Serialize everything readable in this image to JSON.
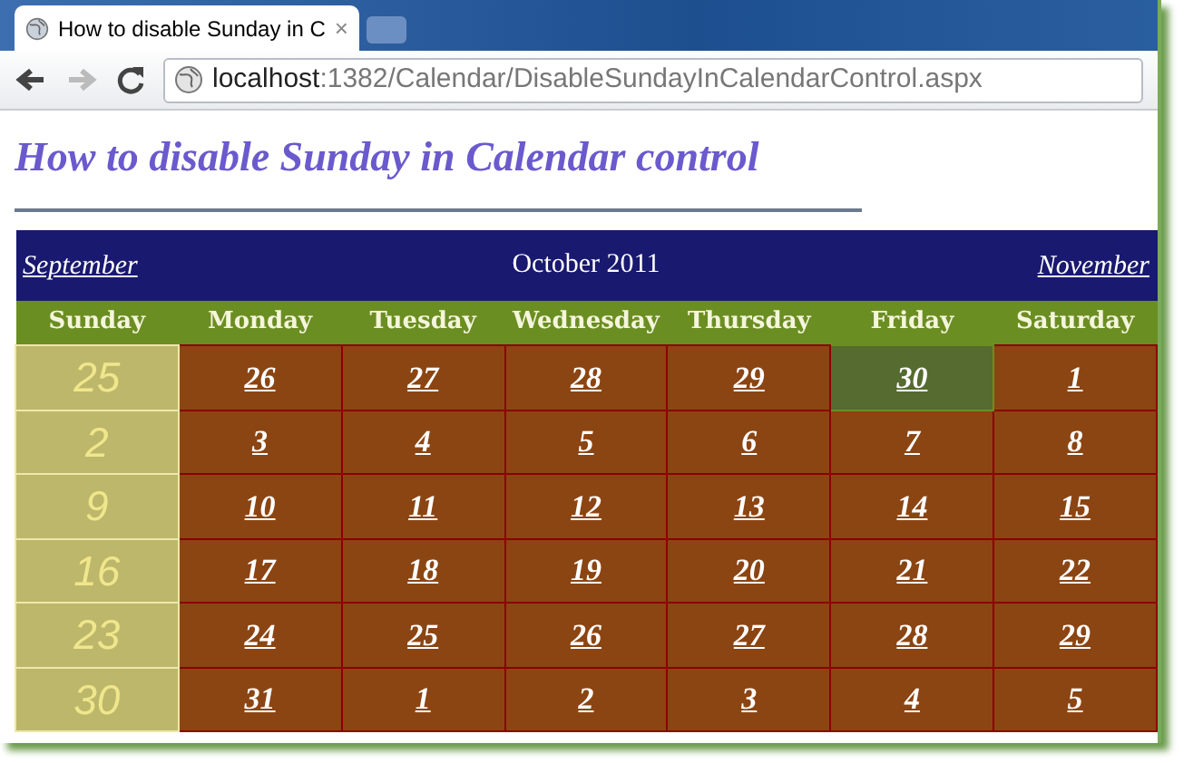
{
  "browser": {
    "tab": {
      "title": "How to disable Sunday in C",
      "close": "×"
    },
    "address": {
      "host": "localhost",
      "path": ":1382/Calendar/DisableSundayInCalendarControl.aspx"
    }
  },
  "heading": "How to disable Sunday in Calendar control",
  "calendar": {
    "prev": "September",
    "title": "October 2011",
    "next": "November",
    "days": [
      "Sunday",
      "Monday",
      "Tuesday",
      "Wednesday",
      "Thursday",
      "Friday",
      "Saturday"
    ],
    "weeks": [
      [
        {
          "day": "25",
          "kind": "disabled",
          "selected": false
        },
        {
          "day": "26",
          "kind": "day",
          "selected": false
        },
        {
          "day": "27",
          "kind": "day",
          "selected": false
        },
        {
          "day": "28",
          "kind": "day",
          "selected": false
        },
        {
          "day": "29",
          "kind": "day",
          "selected": false
        },
        {
          "day": "30",
          "kind": "day",
          "selected": true
        },
        {
          "day": "1",
          "kind": "day",
          "selected": false
        }
      ],
      [
        {
          "day": "2",
          "kind": "disabled",
          "selected": false
        },
        {
          "day": "3",
          "kind": "day",
          "selected": false
        },
        {
          "day": "4",
          "kind": "day",
          "selected": false
        },
        {
          "day": "5",
          "kind": "day",
          "selected": false
        },
        {
          "day": "6",
          "kind": "day",
          "selected": false
        },
        {
          "day": "7",
          "kind": "day",
          "selected": false
        },
        {
          "day": "8",
          "kind": "day",
          "selected": false
        }
      ],
      [
        {
          "day": "9",
          "kind": "disabled",
          "selected": false
        },
        {
          "day": "10",
          "kind": "day",
          "selected": false
        },
        {
          "day": "11",
          "kind": "day",
          "selected": false
        },
        {
          "day": "12",
          "kind": "day",
          "selected": false
        },
        {
          "day": "13",
          "kind": "day",
          "selected": false
        },
        {
          "day": "14",
          "kind": "day",
          "selected": false
        },
        {
          "day": "15",
          "kind": "day",
          "selected": false
        }
      ],
      [
        {
          "day": "16",
          "kind": "disabled",
          "selected": false
        },
        {
          "day": "17",
          "kind": "day",
          "selected": false
        },
        {
          "day": "18",
          "kind": "day",
          "selected": false
        },
        {
          "day": "19",
          "kind": "day",
          "selected": false
        },
        {
          "day": "20",
          "kind": "day",
          "selected": false
        },
        {
          "day": "21",
          "kind": "day",
          "selected": false
        },
        {
          "day": "22",
          "kind": "day",
          "selected": false
        }
      ],
      [
        {
          "day": "23",
          "kind": "disabled",
          "selected": false
        },
        {
          "day": "24",
          "kind": "day",
          "selected": false
        },
        {
          "day": "25",
          "kind": "day",
          "selected": false
        },
        {
          "day": "26",
          "kind": "day",
          "selected": false
        },
        {
          "day": "27",
          "kind": "day",
          "selected": false
        },
        {
          "day": "28",
          "kind": "day",
          "selected": false
        },
        {
          "day": "29",
          "kind": "day",
          "selected": false
        }
      ],
      [
        {
          "day": "30",
          "kind": "disabled",
          "selected": false
        },
        {
          "day": "31",
          "kind": "day",
          "selected": false
        },
        {
          "day": "1",
          "kind": "day",
          "selected": false
        },
        {
          "day": "2",
          "kind": "day",
          "selected": false
        },
        {
          "day": "3",
          "kind": "day",
          "selected": false
        },
        {
          "day": "4",
          "kind": "day",
          "selected": false
        },
        {
          "day": "5",
          "kind": "day",
          "selected": false
        }
      ]
    ]
  }
}
